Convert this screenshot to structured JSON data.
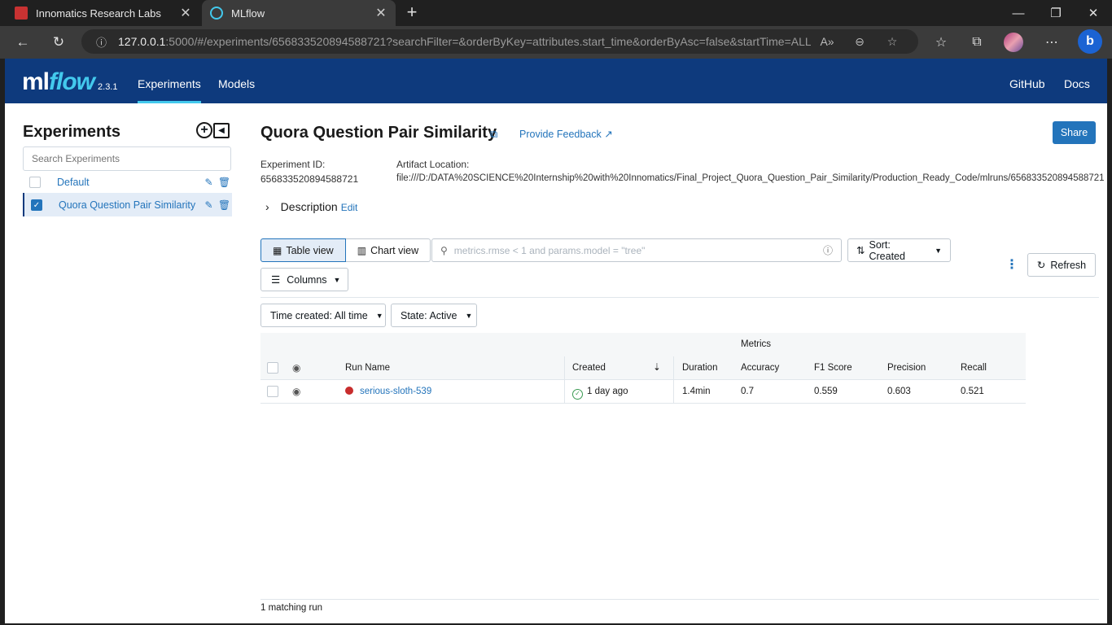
{
  "browser": {
    "tabs": [
      {
        "label": "Innomatics Research Labs",
        "active": false
      },
      {
        "label": "MLflow",
        "active": true
      }
    ],
    "url_host": "127.0.0.1",
    "url_rest": ":5000/#/experiments/656833520894588721?searchFilter=&orderByKey=attributes.start_time&orderByAsc=false&startTime=ALL..."
  },
  "header": {
    "logo_ml": "ml",
    "logo_flow": "flow",
    "version": "2.3.1",
    "nav": [
      "Experiments",
      "Models"
    ],
    "right_links": [
      "GitHub",
      "Docs"
    ]
  },
  "sidebar": {
    "title": "Experiments",
    "search_placeholder": "Search Experiments",
    "items": [
      {
        "name": "Default",
        "selected": false
      },
      {
        "name": "Quora Question Pair Similarity",
        "selected": true
      }
    ]
  },
  "experiment": {
    "title": "Quora Question Pair Similarity",
    "feedback_label": "Provide Feedback",
    "share_label": "Share",
    "id_label": "Experiment ID:",
    "id_value": "656833520894588721",
    "artifact_label": "Artifact Location:",
    "artifact_value": "file:///D:/DATA%20SCIENCE%20Internship%20with%20Innomatics/Final_Project_Quora_Question_Pair_Similarity/Production_Ready_Code/mlruns/656833520894588721",
    "description_label": "Description",
    "edit_label": "Edit"
  },
  "controls": {
    "table_view": "Table view",
    "chart_view": "Chart view",
    "search_placeholder": "metrics.rmse < 1 and params.model = \"tree\"",
    "sort_label": "Sort: Created",
    "refresh_label": "Refresh",
    "columns_label": "Columns",
    "time_filter": "Time created: All time",
    "state_filter": "State: Active"
  },
  "table": {
    "group_header": "Metrics",
    "columns": [
      "Run Name",
      "Created",
      "Duration",
      "Accuracy",
      "F1 Score",
      "Precision",
      "Recall"
    ],
    "rows": [
      {
        "run_name": "serious-sloth-539",
        "created": "1 day ago",
        "duration": "1.4min",
        "accuracy": "0.7",
        "f1": "0.559",
        "precision": "0.603",
        "recall": "0.521"
      }
    ]
  },
  "footer": {
    "matching": "1 matching run"
  },
  "colors": {
    "header_bg": "#0e3a7d",
    "accent": "#43c9ed",
    "link": "#2374bb",
    "run_status": "#c82d2d"
  }
}
